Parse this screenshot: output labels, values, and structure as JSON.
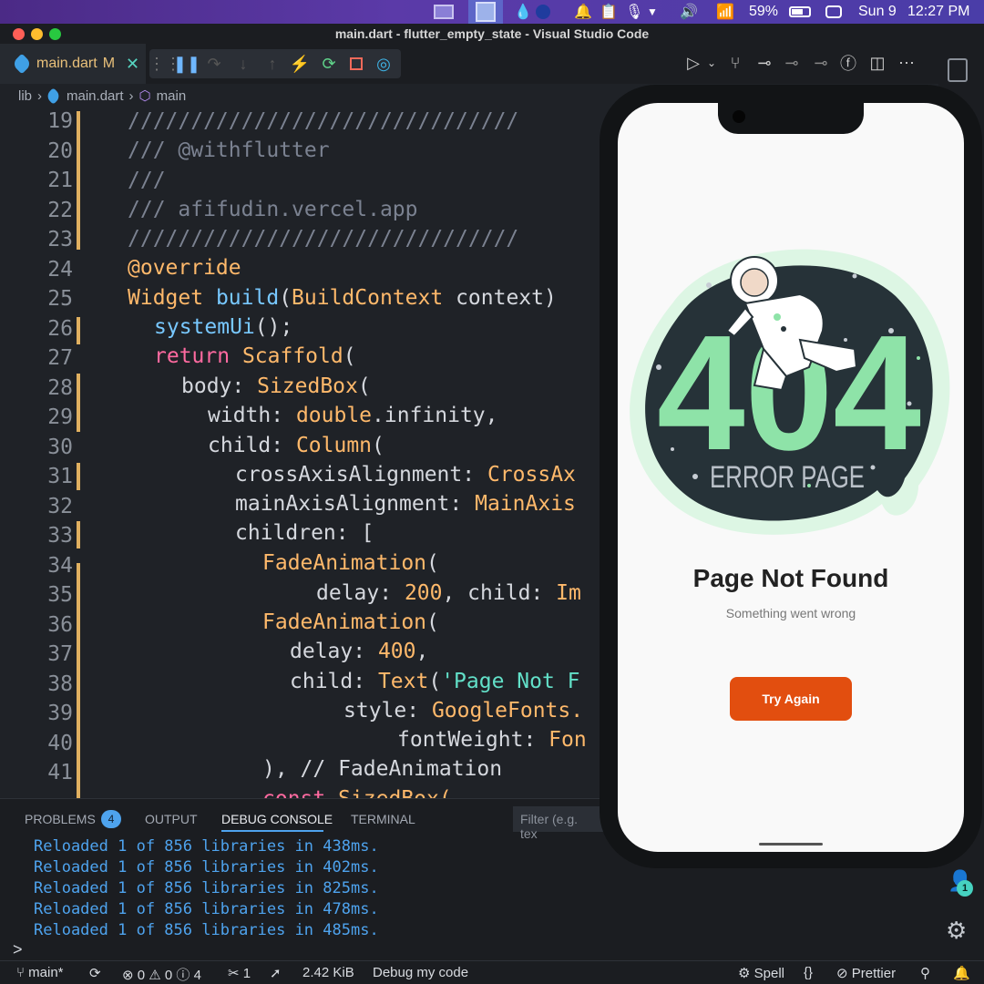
{
  "menubar": {
    "battery": "59%",
    "date": "Sun 9",
    "time": "12:27 PM"
  },
  "window": {
    "title": "main.dart - flutter_empty_state - Visual Studio Code"
  },
  "tab": {
    "name": "main.dart",
    "badge": "M"
  },
  "breadcrumb": {
    "folder": "lib",
    "file": "main.dart",
    "symbol": "main"
  },
  "editor": {
    "lines": [
      {
        "n": "19"
      },
      {
        "n": "20"
      },
      {
        "n": "21"
      },
      {
        "n": "22"
      },
      {
        "n": "23"
      },
      {
        "n": "24"
      },
      {
        "n": "25"
      },
      {
        "n": "26"
      },
      {
        "n": "27"
      },
      {
        "n": "28"
      },
      {
        "n": "29"
      },
      {
        "n": "30"
      },
      {
        "n": "31"
      },
      {
        "n": "32"
      },
      {
        "n": "33"
      },
      {
        "n": "34"
      },
      {
        "n": "35"
      },
      {
        "n": "36"
      },
      {
        "n": "37"
      },
      {
        "n": "38"
      },
      {
        "n": "39"
      },
      {
        "n": "40"
      },
      {
        "n": "41"
      }
    ],
    "tokens": {
      "c19": "///////////////////////////////",
      "c20": "/// @withflutter",
      "c21": "///",
      "c22": "/// afifudin.vercel.app",
      "c23": "///////////////////////////////",
      "c24": "@override",
      "c25a": "Widget ",
      "c25b": "build",
      "c25c": "(",
      "c25d": "BuildContext",
      "c25e": " context)",
      "c26a": "systemUi",
      "c26b": "();",
      "c27a": "return ",
      "c27b": "Scaffold",
      "c27c": "(",
      "c28a": "body: ",
      "c28b": "SizedBox",
      "c28c": "(",
      "c29a": "width: ",
      "c29b": "double",
      "c29c": ".infinity,",
      "c30a": "child: ",
      "c30b": "Column",
      "c30c": "(",
      "c31a": "crossAxisAlignment: ",
      "c31b": "CrossAx",
      "c32a": "mainAxisAlignment: ",
      "c32b": "MainAxis",
      "c33": "children: [",
      "c34a": "FadeAnimation",
      "c34b": "(",
      "c35a": "delay: ",
      "c35b": "200",
      "c35c": ", child: ",
      "c35d": "Im",
      "c36a": "FadeAnimation",
      "c36b": "(",
      "c37a": "delay: ",
      "c37b": "400",
      "c37c": ",",
      "c38a": "child: ",
      "c38b": "Text",
      "c38c": "(",
      "c38d": "'Page Not F",
      "c39a": "style: ",
      "c39b": "GoogleFonts.",
      "c40a": "fontWeight: ",
      "c40b": "Fon",
      "c41a": "), ",
      "c41b": "// FadeAnimation",
      "c42a": "const ",
      "c42b": "SizedBox("
    }
  },
  "panel": {
    "tabs": {
      "problems": "PROBLEMS",
      "problems_count": "4",
      "output": "OUTPUT",
      "debug": "DEBUG CONSOLE",
      "terminal": "TERMINAL"
    },
    "filter_placeholder": "Filter (e.g. tex",
    "logs": [
      "Reloaded 1 of 856 libraries in 438ms.",
      "Reloaded 1 of 856 libraries in 402ms.",
      "Reloaded 1 of 856 libraries in 825ms.",
      "Reloaded 1 of 856 libraries in 478ms.",
      "Reloaded 1 of 856 libraries in 485ms."
    ],
    "prompt": ">"
  },
  "statusbar": {
    "branch": "main*",
    "errors": "0",
    "warnings": "0",
    "info": "4",
    "tools": "1",
    "size": "2.42 KiB",
    "debug": "Debug my code",
    "spell": "Spell",
    "prettier": "Prettier"
  },
  "rightbar": {
    "accounts_badge": "1"
  },
  "phone": {
    "illustration_big": "404",
    "illustration_sub": "ERROR PAGE",
    "title": "Page Not Found",
    "subtitle": "Something went wrong",
    "button": "Try Again"
  },
  "colors": {
    "accent_orange": "#e24e0f",
    "mint": "#8ee3a8",
    "blob_dark": "#263238",
    "tab_modified": "#e9c07a"
  }
}
